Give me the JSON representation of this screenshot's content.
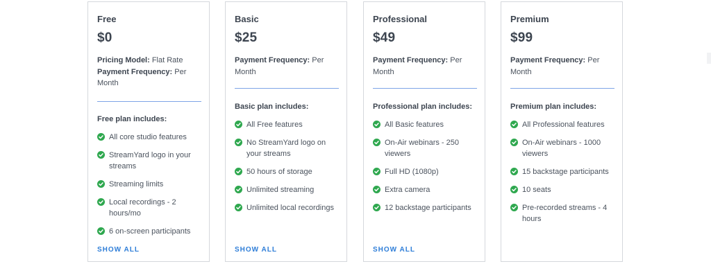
{
  "plans": [
    {
      "name": "Free",
      "price": "$0",
      "meta": [
        {
          "key": "Pricing Model:",
          "value": " Flat Rate"
        },
        {
          "key": "Payment Frequency:",
          "value": " Per Month"
        }
      ],
      "includes_title": "Free plan includes:",
      "features": [
        "All core studio features",
        "StreamYard logo in your streams",
        "Streaming limits",
        "Local recordings - 2 hours/mo",
        "6 on-screen participants"
      ],
      "show_all": "SHOW ALL"
    },
    {
      "name": "Basic",
      "price": "$25",
      "meta": [
        {
          "key": "Payment Frequency:",
          "value": " Per Month"
        }
      ],
      "includes_title": "Basic plan includes:",
      "features": [
        "All Free features",
        "No StreamYard logo on your streams",
        "50 hours of storage",
        "Unlimited streaming",
        "Unlimited local recordings"
      ],
      "show_all": "SHOW ALL"
    },
    {
      "name": "Professional",
      "price": "$49",
      "meta": [
        {
          "key": "Payment Frequency:",
          "value": " Per Month"
        }
      ],
      "includes_title": "Professional plan includes:",
      "features": [
        "All Basic features",
        "On-Air webinars - 250 viewers",
        "Full HD (1080p)",
        "Extra camera",
        "12 backstage participants"
      ],
      "show_all": "SHOW ALL"
    },
    {
      "name": "Premium",
      "price": "$99",
      "meta": [
        {
          "key": "Payment Frequency:",
          "value": " Per Month"
        }
      ],
      "includes_title": "Premium plan includes:",
      "features": [
        "All Professional features",
        "On-Air webinars - 1000 viewers",
        "15 backstage participants",
        "10 seats",
        "Pre-recorded streams - 4 hours"
      ]
    }
  ],
  "colors": {
    "accent_divider": "#7ea4e6",
    "check": "#2fa84f",
    "link": "#2f7ed8",
    "card_border": "#d5d8dc"
  },
  "icons": {
    "feature_bullet": "check-circle-icon"
  }
}
